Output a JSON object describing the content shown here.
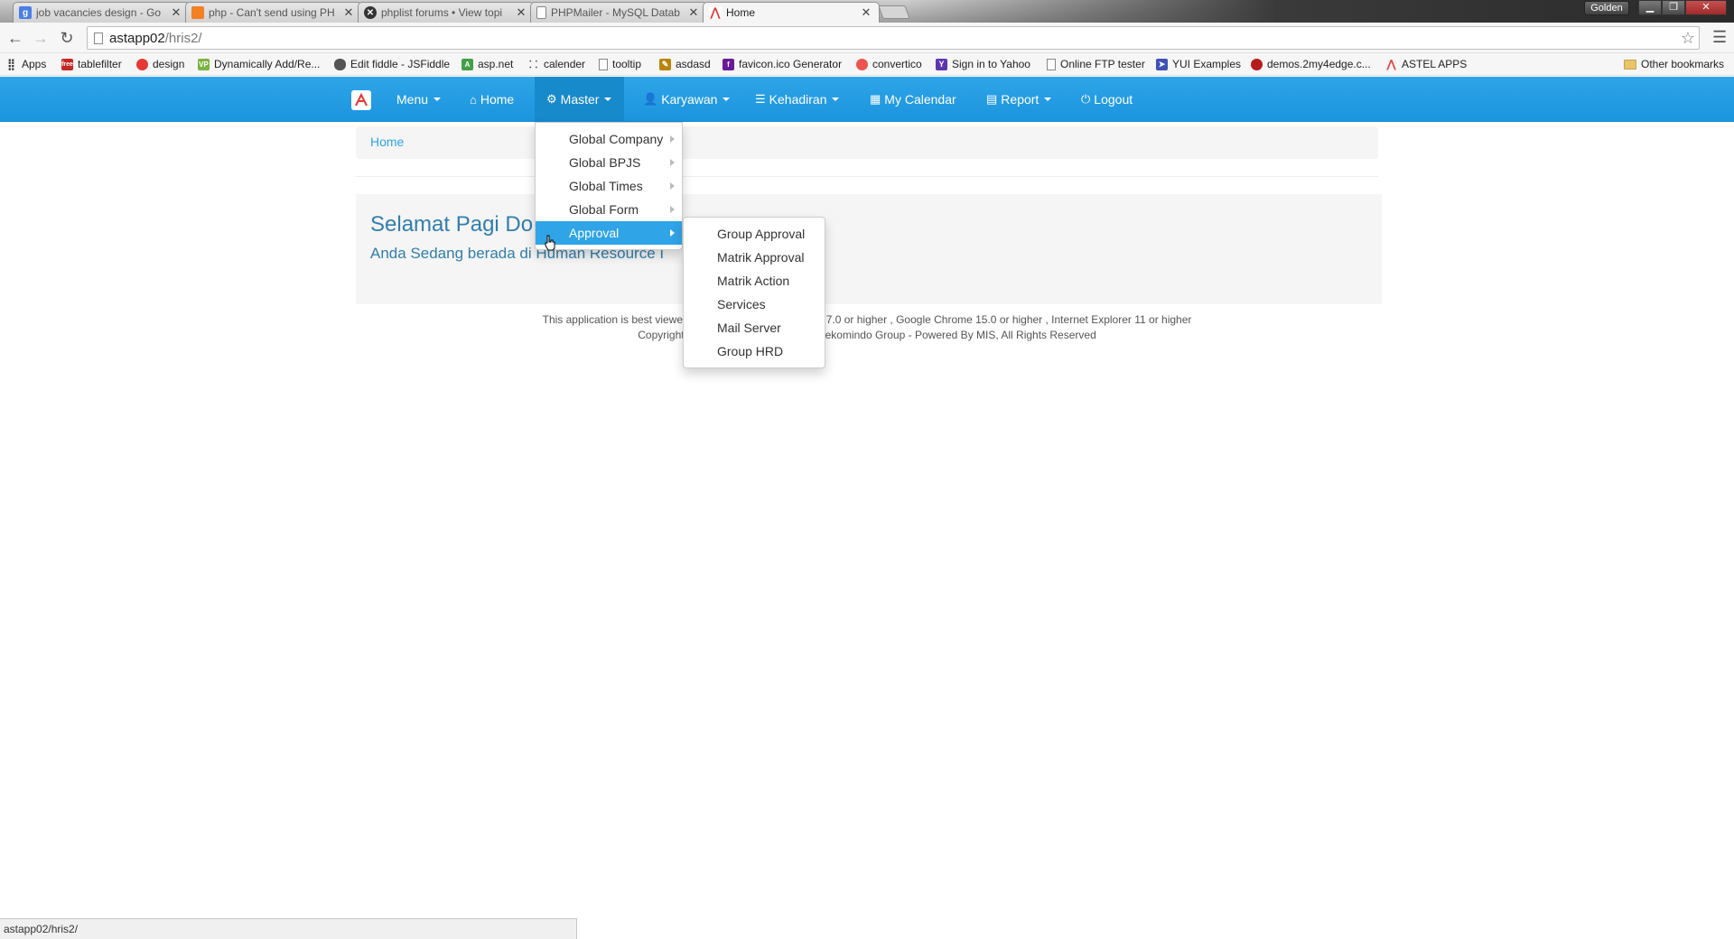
{
  "browser": {
    "tabs": [
      {
        "title": "job vacancies design - Go",
        "icon": "google-icon",
        "color": "#4a7ee8"
      },
      {
        "title": "php - Can't send using PH",
        "icon": "stackoverflow-icon",
        "color": "#f48024"
      },
      {
        "title": "phplist forums • View topi",
        "icon": "phplist-icon",
        "color": "#333333"
      },
      {
        "title": "PHPMailer - MySQL Datab",
        "icon": "page-icon",
        "color": "#ffffff"
      },
      {
        "title": "Home",
        "icon": "app-logo-icon",
        "color": "#e53935"
      }
    ],
    "profile_label": "Golden",
    "url_host": "astapp02",
    "url_path": "/hris2/",
    "bookmarks": [
      {
        "label": "Apps",
        "icon": "apps-grid-icon"
      },
      {
        "label": "tablefilter",
        "icon": "free-icon"
      },
      {
        "label": "design",
        "icon": "hexagon-icon"
      },
      {
        "label": "Dynamically Add/Re...",
        "icon": "vp-icon"
      },
      {
        "label": "Edit fiddle - JSFiddle",
        "icon": "cloud-icon"
      },
      {
        "label": "asp.net",
        "icon": "aspnet-icon"
      },
      {
        "label": "calender",
        "icon": "calendar-icon"
      },
      {
        "label": "tooltip",
        "icon": "page-icon"
      },
      {
        "label": "asdasd",
        "icon": "pencil-icon"
      },
      {
        "label": "favicon.ico Generator",
        "icon": "favicon-icon"
      },
      {
        "label": "convertico",
        "icon": "convertico-icon"
      },
      {
        "label": "Sign in to Yahoo",
        "icon": "yahoo-icon"
      },
      {
        "label": "Online FTP tester",
        "icon": "page-icon"
      },
      {
        "label": "YUI Examples",
        "icon": "yui-icon"
      },
      {
        "label": "demos.2my4edge.c...",
        "icon": "demos-icon"
      },
      {
        "label": "ASTEL APPS",
        "icon": "app-logo-icon"
      },
      {
        "label": "Other bookmarks",
        "icon": "folder-icon"
      }
    ],
    "status_text": "astapp02/hris2/"
  },
  "navbar": {
    "items": [
      {
        "label": "Menu",
        "icon": "",
        "caret": true
      },
      {
        "label": "Home",
        "icon": "home-icon",
        "caret": false
      },
      {
        "label": "Master",
        "icon": "cog-icon",
        "caret": true
      },
      {
        "label": "Karyawan",
        "icon": "user-icon",
        "caret": true
      },
      {
        "label": "Kehadiran",
        "icon": "list-icon",
        "caret": true
      },
      {
        "label": "My Calendar",
        "icon": "calendar-icon",
        "caret": false
      },
      {
        "label": "Report",
        "icon": "grid-icon",
        "caret": true
      },
      {
        "label": "Logout",
        "icon": "power-icon",
        "caret": false
      }
    ],
    "accent": "#2fa4e7"
  },
  "master_menu": {
    "items": [
      {
        "label": "Global Company"
      },
      {
        "label": "Global BPJS"
      },
      {
        "label": "Global Times"
      },
      {
        "label": "Global Form"
      },
      {
        "label": "Approval"
      }
    ],
    "active_index": 4
  },
  "approval_submenu": {
    "items": [
      {
        "label": "Group Approval"
      },
      {
        "label": "Matrik Approval"
      },
      {
        "label": "Matrik Action"
      },
      {
        "label": "Services"
      },
      {
        "label": "Mail Server"
      },
      {
        "label": "Group HRD"
      }
    ]
  },
  "page": {
    "breadcrumb": "Home",
    "greeting": "Selamat Pagi Do",
    "subtitle": "Anda Sedang berada di Human Resource I",
    "footer_line1_left": "This application is best viewed",
    "footer_line1_right": "7.0 or higher , Google Chrome 15.0 or higher , Internet Explorer 11 or higher",
    "footer_line2_left": "Copyright",
    "footer_line2_right": "ekomindo Group - Powered By MIS, All Rights Reserved"
  }
}
